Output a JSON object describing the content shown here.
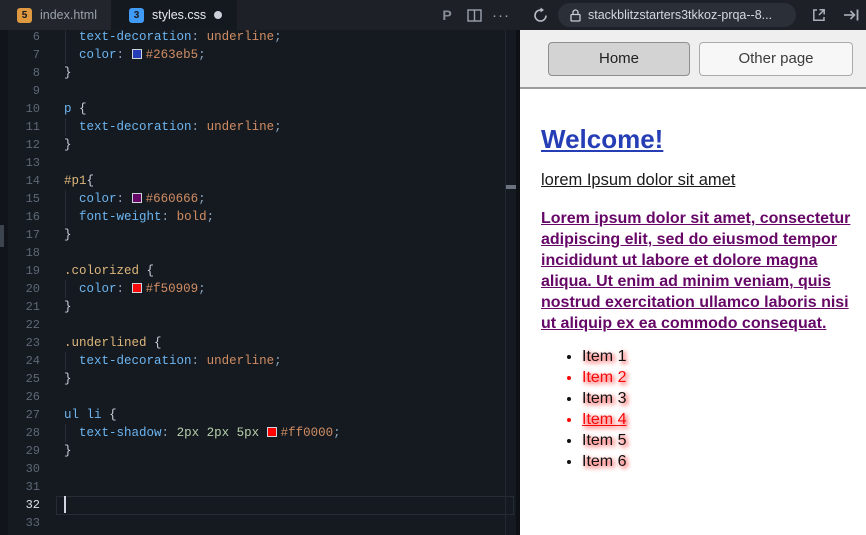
{
  "tab_bar": {
    "tabs": [
      {
        "label": "index.html",
        "icon": "html5-file-icon",
        "icon_glyph": "5",
        "icon_color": "#dd9840",
        "active": false,
        "modified": false
      },
      {
        "label": "styles.css",
        "icon": "css3-file-icon",
        "icon_glyph": "3",
        "icon_color": "#3f9bf5",
        "active": true,
        "modified": true
      }
    ]
  },
  "toolbar": {
    "prettier_label": "P",
    "ellipsis_glyph": "···",
    "url": "stackblitzstarters3tkkoz-prqa--8..."
  },
  "editor": {
    "cursor_line": 32,
    "colors": {
      "background": "#151a21",
      "property": "#6cb5f0",
      "value": "#d18d62",
      "number": "#b5cea8",
      "selector_class": "#dcb67a",
      "selector_element": "#6cb5f0"
    },
    "lines": [
      {
        "n": 6,
        "g": true,
        "t": [
          [
            "ws",
            "  "
          ],
          [
            "prop",
            "text-decoration"
          ],
          [
            "pun",
            ":"
          ],
          [
            "ws",
            " "
          ],
          [
            "val",
            "underline"
          ],
          [
            "pun",
            ";"
          ]
        ]
      },
      {
        "n": 7,
        "g": true,
        "t": [
          [
            "ws",
            "  "
          ],
          [
            "prop",
            "color"
          ],
          [
            "pun",
            ":"
          ],
          [
            "ws",
            " "
          ],
          [
            "swatch",
            "#263eb5"
          ],
          [
            "val",
            "#263eb5"
          ],
          [
            "pun",
            ";"
          ]
        ]
      },
      {
        "n": 8,
        "g": false,
        "t": [
          [
            "brace",
            "}"
          ]
        ]
      },
      {
        "n": 9,
        "g": false,
        "t": []
      },
      {
        "n": 10,
        "g": false,
        "t": [
          [
            "sele",
            "p"
          ],
          [
            "ws",
            " "
          ],
          [
            "brace",
            "{"
          ]
        ]
      },
      {
        "n": 11,
        "g": true,
        "t": [
          [
            "ws",
            "  "
          ],
          [
            "prop",
            "text-decoration"
          ],
          [
            "pun",
            ":"
          ],
          [
            "ws",
            " "
          ],
          [
            "val",
            "underline"
          ],
          [
            "pun",
            ";"
          ]
        ]
      },
      {
        "n": 12,
        "g": false,
        "t": [
          [
            "brace",
            "}"
          ]
        ]
      },
      {
        "n": 13,
        "g": false,
        "t": []
      },
      {
        "n": 14,
        "g": false,
        "t": [
          [
            "selc",
            "#p1"
          ],
          [
            "brace",
            "{"
          ]
        ]
      },
      {
        "n": 15,
        "g": true,
        "t": [
          [
            "ws",
            "  "
          ],
          [
            "prop",
            "color"
          ],
          [
            "pun",
            ":"
          ],
          [
            "ws",
            " "
          ],
          [
            "swatch",
            "#660666"
          ],
          [
            "val",
            "#660666"
          ],
          [
            "pun",
            ";"
          ]
        ]
      },
      {
        "n": 16,
        "g": true,
        "t": [
          [
            "ws",
            "  "
          ],
          [
            "prop",
            "font-weight"
          ],
          [
            "pun",
            ":"
          ],
          [
            "ws",
            " "
          ],
          [
            "val",
            "bold"
          ],
          [
            "pun",
            ";"
          ]
        ]
      },
      {
        "n": 17,
        "g": false,
        "t": [
          [
            "brace",
            "}"
          ]
        ]
      },
      {
        "n": 18,
        "g": false,
        "t": []
      },
      {
        "n": 19,
        "g": false,
        "t": [
          [
            "selc",
            ".colorized"
          ],
          [
            "ws",
            " "
          ],
          [
            "brace",
            "{"
          ]
        ]
      },
      {
        "n": 20,
        "g": true,
        "t": [
          [
            "ws",
            "  "
          ],
          [
            "prop",
            "color"
          ],
          [
            "pun",
            ":"
          ],
          [
            "ws",
            " "
          ],
          [
            "swatch",
            "#f50909"
          ],
          [
            "val",
            "#f50909"
          ],
          [
            "pun",
            ";"
          ]
        ]
      },
      {
        "n": 21,
        "g": false,
        "t": [
          [
            "brace",
            "}"
          ]
        ]
      },
      {
        "n": 22,
        "g": false,
        "t": []
      },
      {
        "n": 23,
        "g": false,
        "t": [
          [
            "selc",
            ".underlined"
          ],
          [
            "ws",
            " "
          ],
          [
            "brace",
            "{"
          ]
        ]
      },
      {
        "n": 24,
        "g": true,
        "t": [
          [
            "ws",
            "  "
          ],
          [
            "prop",
            "text-decoration"
          ],
          [
            "pun",
            ":"
          ],
          [
            "ws",
            " "
          ],
          [
            "val",
            "underline"
          ],
          [
            "pun",
            ";"
          ]
        ]
      },
      {
        "n": 25,
        "g": false,
        "t": [
          [
            "brace",
            "}"
          ]
        ]
      },
      {
        "n": 26,
        "g": false,
        "t": []
      },
      {
        "n": 27,
        "g": false,
        "t": [
          [
            "sele",
            "ul"
          ],
          [
            "ws",
            " "
          ],
          [
            "sele",
            "li"
          ],
          [
            "ws",
            " "
          ],
          [
            "brace",
            "{"
          ]
        ]
      },
      {
        "n": 28,
        "g": true,
        "t": [
          [
            "ws",
            "  "
          ],
          [
            "prop",
            "text-shadow"
          ],
          [
            "pun",
            ":"
          ],
          [
            "ws",
            " "
          ],
          [
            "num",
            "2px"
          ],
          [
            "ws",
            " "
          ],
          [
            "num",
            "2px"
          ],
          [
            "ws",
            " "
          ],
          [
            "num",
            "5px"
          ],
          [
            "ws",
            " "
          ],
          [
            "swatch",
            "#ff0000"
          ],
          [
            "val",
            "#ff0000"
          ],
          [
            "pun",
            ";"
          ]
        ]
      },
      {
        "n": 29,
        "g": false,
        "t": [
          [
            "brace",
            "}"
          ]
        ]
      },
      {
        "n": 30,
        "g": false,
        "t": []
      },
      {
        "n": 31,
        "g": false,
        "t": []
      },
      {
        "n": 32,
        "g": false,
        "t": []
      },
      {
        "n": 33,
        "g": false,
        "t": []
      }
    ]
  },
  "preview": {
    "nav_buttons": {
      "home": "Home",
      "other": "Other page"
    },
    "heading": "Welcome!",
    "subheading": "lorem Ipsum dolor sit amet",
    "paragraph": "Lorem ipsum dolor sit amet, consectetur adipiscing elit, sed do eiusmod tempor incididunt ut labore et dolore magna aliqua. Ut enim ad minim veniam, quis nostrud exercitation ullamco laboris nisi ut aliquip ex ea commodo consequat.",
    "list": {
      "items": [
        {
          "label": "Item 1",
          "colorized": false,
          "underlined": false
        },
        {
          "label": "Item 2",
          "colorized": true,
          "underlined": false
        },
        {
          "label": "Item 3",
          "colorized": false,
          "underlined": false
        },
        {
          "label": "Item 4",
          "colorized": true,
          "underlined": true
        },
        {
          "label": "Item 5",
          "colorized": false,
          "underlined": false
        },
        {
          "label": "Item 6",
          "colorized": false,
          "underlined": false
        }
      ]
    },
    "colors": {
      "heading": "#263eb5",
      "paragraph": "#660666",
      "colorized": "#f50909",
      "shadow": "#ff0000"
    }
  }
}
